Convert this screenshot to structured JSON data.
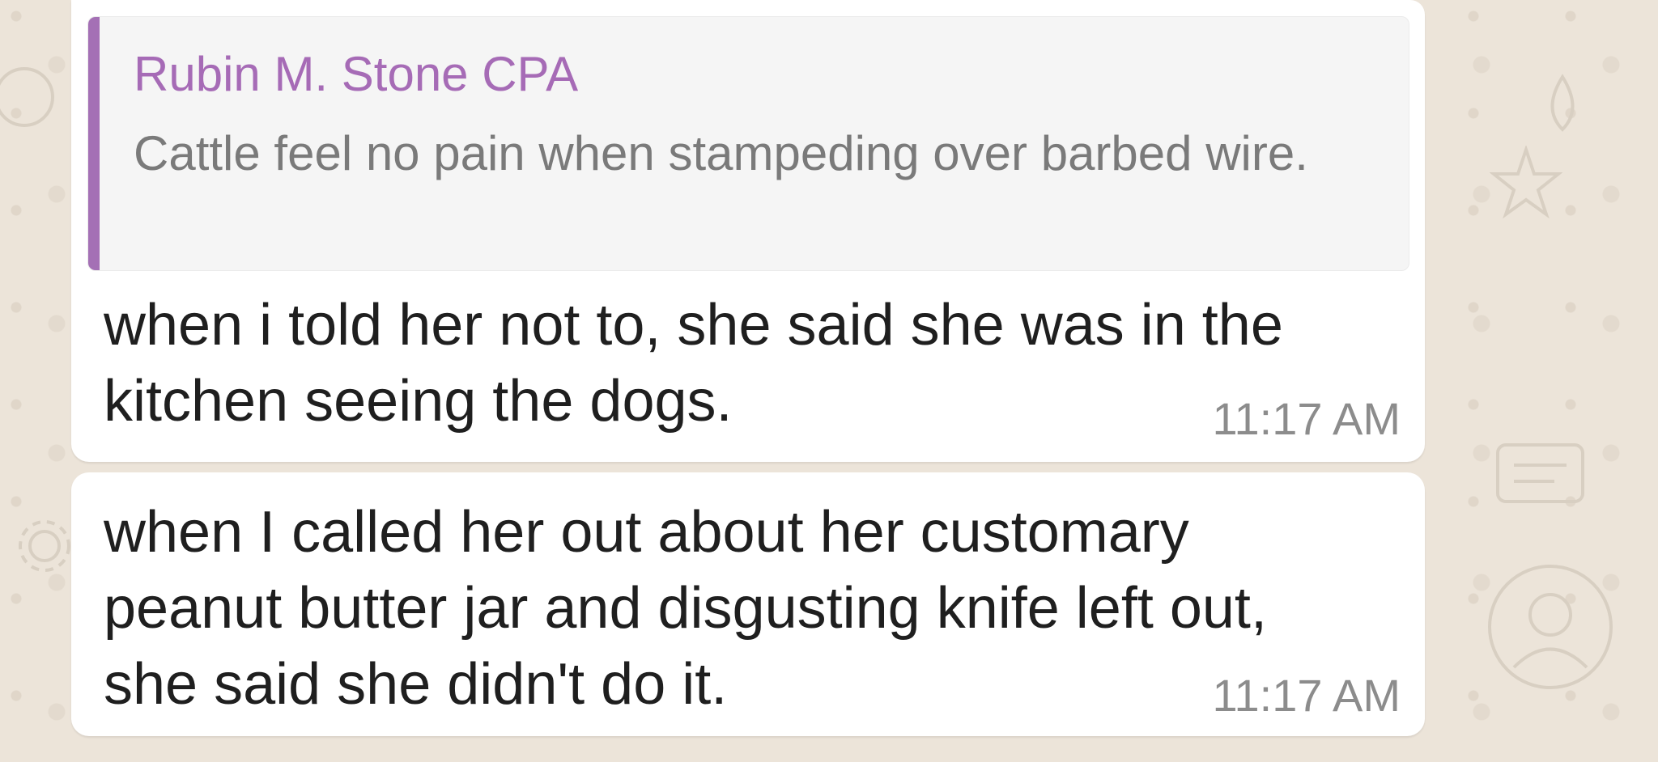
{
  "chat": {
    "messages": [
      {
        "quote": {
          "author": "Rubin M. Stone CPA",
          "text": "Cattle feel no pain when stampeding over barbed wire."
        },
        "text": "when i told her not to, she said she was in the kitchen seeing the dogs.",
        "time": "11:17 AM"
      },
      {
        "text": "when I called her out about her customary peanut butter jar and disgusting knife left out, she said she didn't do it.",
        "time": "11:17 AM"
      }
    ]
  },
  "colors": {
    "wallpaper": "#ece4d9",
    "quote_accent": "#a470b5",
    "quote_author": "#a66bb6",
    "bubble": "#ffffff"
  }
}
